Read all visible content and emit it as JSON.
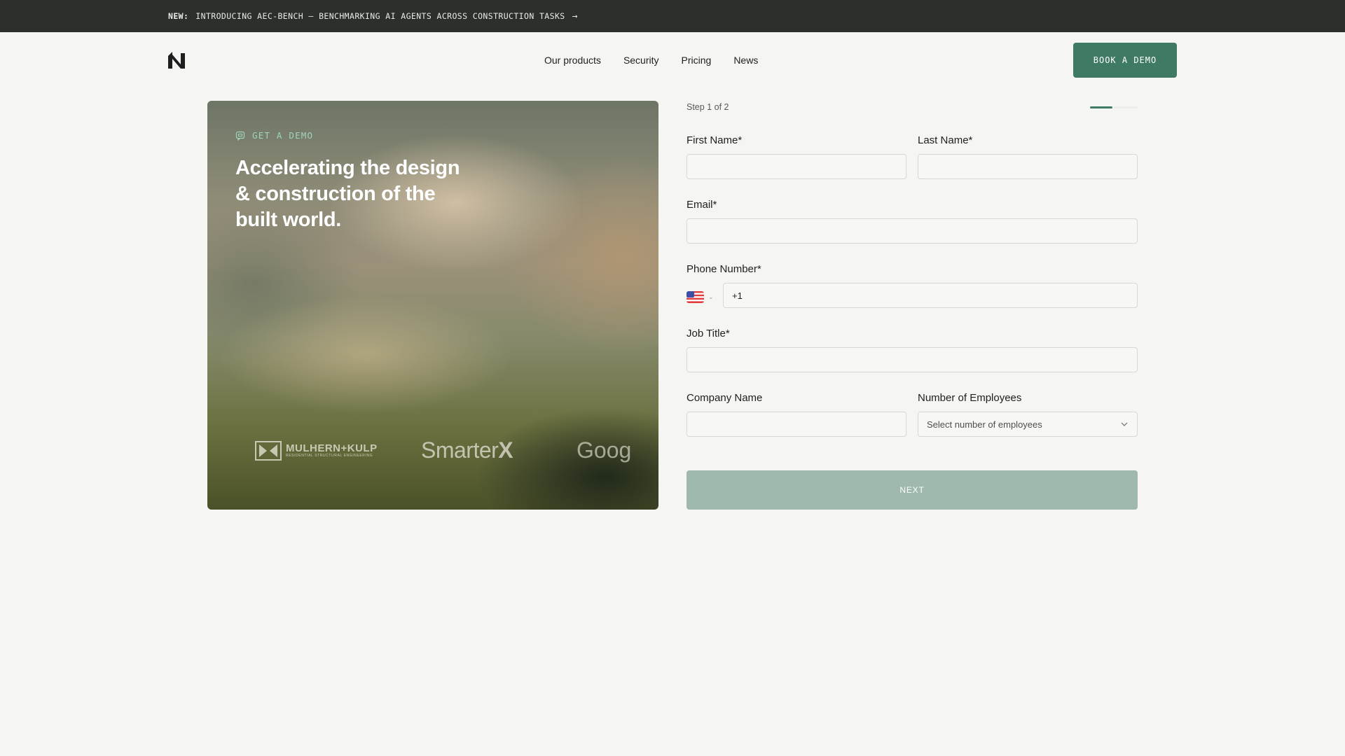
{
  "announcement": {
    "tag": "NEW:",
    "text": "INTRODUCING AEC-BENCH — BENCHMARKING AI AGENTS ACROSS CONSTRUCTION TASKS",
    "arrow": "→"
  },
  "header": {
    "logo_icon": "n-logo-icon",
    "nav": [
      "Our products",
      "Security",
      "Pricing",
      "News"
    ],
    "cta_label": "BOOK A DEMO",
    "accent_color": "#3f7a64"
  },
  "hero": {
    "eyebrow": "GET A DEMO",
    "headline": "Accelerating the design & construction of the built world.",
    "logos": {
      "mulhern_kulp": "MULHERN+KULP",
      "mulhern_kulp_sub": "RESIDENTIAL STRUCTURAL ENGINEERING",
      "smarterx_a": "Smarter",
      "smarterx_b": "X",
      "google_partial": "Goog"
    }
  },
  "form": {
    "step_text": "Step 1 of 2",
    "progress": {
      "current": 1,
      "total": 2
    },
    "first_name_label": "First Name*",
    "last_name_label": "Last Name*",
    "email_label": "Email*",
    "phone_label": "Phone Number*",
    "phone_value": "+1",
    "phone_country_icon": "us-flag-icon",
    "job_title_label": "Job Title*",
    "company_label": "Company Name",
    "employees_label": "Number of Employees",
    "employees_placeholder": "Select number of employees",
    "next_label": "NEXT"
  }
}
